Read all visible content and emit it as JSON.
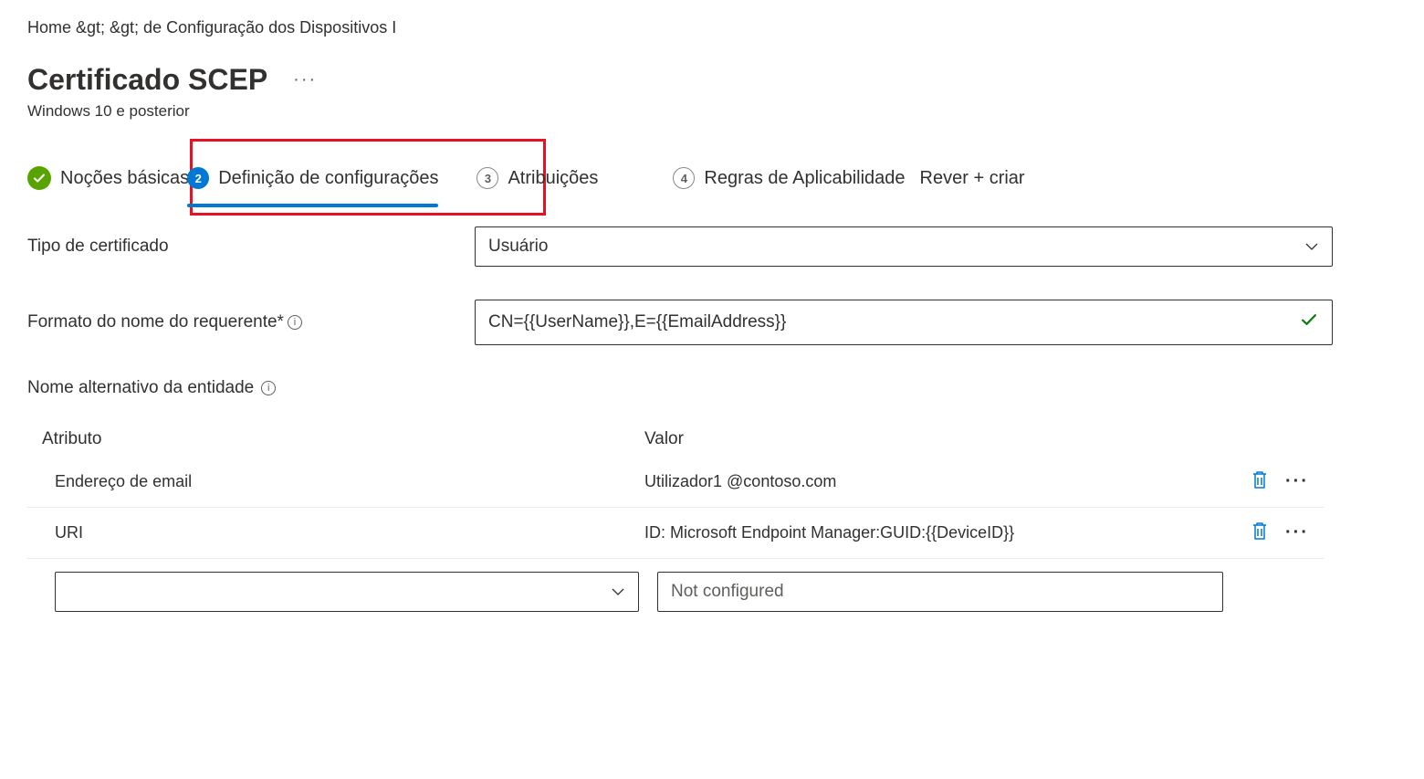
{
  "breadcrumb": "Home &gt;  &gt; de Configuração dos Dispositivos I",
  "page": {
    "title": "Certificado SCEP",
    "subtitle": "Windows 10 e posterior"
  },
  "wizard": {
    "steps": [
      {
        "label": "Noções básicas",
        "state": "done"
      },
      {
        "num": "2",
        "label": "Definição de configurações",
        "state": "active"
      },
      {
        "num": "3",
        "label": "Atribuições",
        "state": "pending"
      },
      {
        "num": "4",
        "label": "Regras de Aplicabilidade",
        "state": "pending"
      },
      {
        "label": "Rever + criar",
        "state": "pending-nonum"
      }
    ]
  },
  "form": {
    "cert_type_label": "Tipo de certificado",
    "cert_type_value": "Usuário",
    "subject_name_label": "Formato do nome do requerente*",
    "subject_name_value": "CN={{UserName}},E={{EmailAddress}}",
    "san_label": "Nome alternativo da entidade",
    "san_header_attr": "Atributo",
    "san_header_val": "Valor",
    "san_rows": [
      {
        "attr": "Endereço de email",
        "val": "Utilizador1 @contoso.com"
      },
      {
        "attr": "URI",
        "val": "ID: Microsoft Endpoint Manager:GUID:{{DeviceID}}"
      }
    ],
    "new_row_placeholder": "Not configured"
  }
}
